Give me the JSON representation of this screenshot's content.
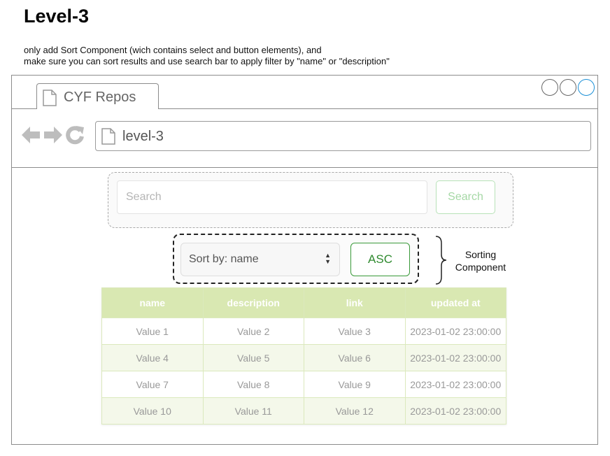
{
  "title": "Level-3",
  "description": [
    "only add Sort Component (wich contains select and button elements), and",
    "make sure you can sort results and use search bar to apply filter by \"name\" or \"description\""
  ],
  "browser": {
    "tab_label": "CYF Repos",
    "url": "level-3"
  },
  "search": {
    "placeholder": "Search",
    "button_label": "Search"
  },
  "sort": {
    "select_value": "Sort by: name",
    "button_label": "ASC",
    "annotation_line1": "Sorting",
    "annotation_line2": "Component"
  },
  "table": {
    "headers": [
      "name",
      "description",
      "link",
      "updated at"
    ],
    "rows": [
      [
        "Value 1",
        "Value 2",
        "Value 3",
        "2023-01-02 23:00:00"
      ],
      [
        "Value 4",
        "Value 5",
        "Value 6",
        "2023-01-02 23:00:00"
      ],
      [
        "Value 7",
        "Value 8",
        "Value 9",
        "2023-01-02 23:00:00"
      ],
      [
        "Value 10",
        "Value 11",
        "Value 12",
        "2023-01-02 23:00:00"
      ]
    ]
  },
  "colors": {
    "header_bg": "#d9e8b2",
    "accent_green": "#3a9a3a",
    "active_circle": "#1a8fd6"
  },
  "icons": [
    "document-icon",
    "back-arrow-icon",
    "forward-arrow-icon",
    "refresh-icon",
    "window-control-icon",
    "updown-chevron-icon",
    "brace-icon"
  ]
}
